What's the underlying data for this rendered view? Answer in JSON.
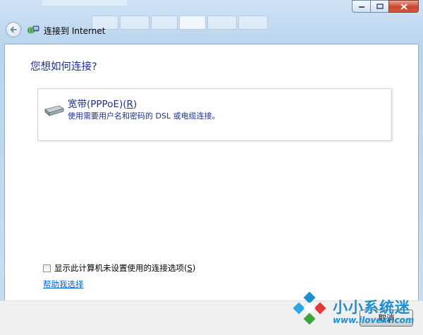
{
  "window": {
    "title": "连接到 Internet",
    "question": "您想如何连接?"
  },
  "option": {
    "title": "宽带(PPPoE)(",
    "title_accel": "R",
    "title_close": ")",
    "description": "使用需要用户名和密码的 DSL 或电缆连接。",
    "icon": "modem-icon"
  },
  "checkbox": {
    "label": "显示此计算机未设置使用的连接选项(",
    "accel": "S",
    "close": ")",
    "checked": false
  },
  "help_link": "帮助我选择",
  "buttons": {
    "cancel": "取消"
  },
  "watermark": {
    "name": "小小系统迷",
    "url": "www.ilovext.com"
  },
  "colors": {
    "heading": "#1e3287",
    "link": "#0066cc",
    "watermark": "#1b8fd0"
  }
}
